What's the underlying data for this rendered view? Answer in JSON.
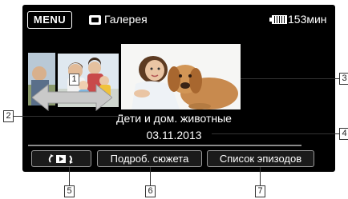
{
  "header": {
    "menu_label": "MENU",
    "gallery_label": "Галерея",
    "battery_time": "153мин"
  },
  "album": {
    "title": "Дети и дом. животные",
    "date": "03.11.2013"
  },
  "buttons": {
    "slideshow_icon": "slideshow-icon",
    "story_details": "Подроб. сюжета",
    "scene_list": "Список эпизодов"
  },
  "callouts": [
    "1",
    "2",
    "3",
    "4",
    "5",
    "6",
    "7"
  ]
}
